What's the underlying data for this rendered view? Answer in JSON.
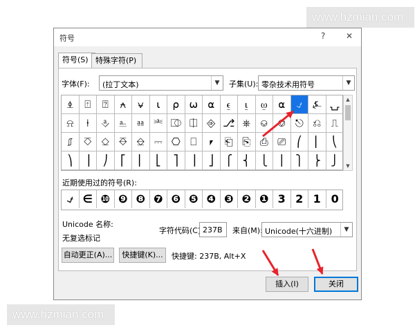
{
  "watermark": "www.hzmian.com",
  "dialog": {
    "title": "符号",
    "help_icon": "?",
    "close_icon": "✕"
  },
  "tabs": [
    {
      "label": "符号(S)"
    },
    {
      "label": "特殊字符(P)"
    }
  ],
  "font": {
    "label": "字体(F):",
    "value": "(拉丁文本)"
  },
  "subset": {
    "label": "子集(U):",
    "value": "零杂技术用符号"
  },
  "grid_rows": [
    [
      "⍎",
      "⍐",
      "⍰",
      "⍲",
      "⍱",
      "⍳",
      "⍴",
      "⍵",
      "⍺",
      "⍷",
      "⍸",
      "⍹",
      "⍺",
      "⍻",
      "⍼",
      "⍽"
    ],
    [
      "⍾",
      "⍿",
      "⎀",
      "⎁",
      "⎂",
      "⎃",
      "⎄",
      "⎅",
      "⎆",
      "⎇",
      "⎈",
      "⎉",
      "⎊",
      "⎋",
      "⎌",
      "⎍"
    ],
    [
      "⎎",
      "⎏",
      "⎐",
      "⎑",
      "⎒",
      "⎓",
      "⎔",
      "⎕",
      "⎖",
      "⎗",
      "⎘",
      "⎙",
      "⎚",
      "⎛",
      "⎜",
      "⎝"
    ],
    [
      "⎞",
      "⎟",
      "⎠",
      "⎡",
      "⎢",
      "⎣",
      "⎤",
      "⎥",
      "⎦",
      "⎧",
      "⎨",
      "⎩",
      "⎪",
      "⎫",
      "⎬",
      "⎭"
    ]
  ],
  "recent_label": "近期使用过的符号(R):",
  "recent": [
    "⍻",
    "∈",
    "❿",
    "❾",
    "❽",
    "❼",
    "❻",
    "❺",
    "❹",
    "❸",
    "❷",
    "❶",
    "3",
    "2",
    "1",
    "0"
  ],
  "unicode_name_label": "Unicode 名称:",
  "unicode_name_value": "无复选标记",
  "char_code_label": "字符代码(C):",
  "char_code_value": "237B",
  "from_label": "来自(M):",
  "from_value": "Unicode(十六进制)",
  "autocorrect_button": "自动更正(A)...",
  "shortcut_button": "快捷键(K)...",
  "shortcut_text": "快捷键: 237B, Alt+X",
  "insert_button": "插入(I)",
  "close_button": "关闭",
  "colors": {
    "accent": "#1673e6",
    "annotation_arrow": "#e8232c"
  }
}
